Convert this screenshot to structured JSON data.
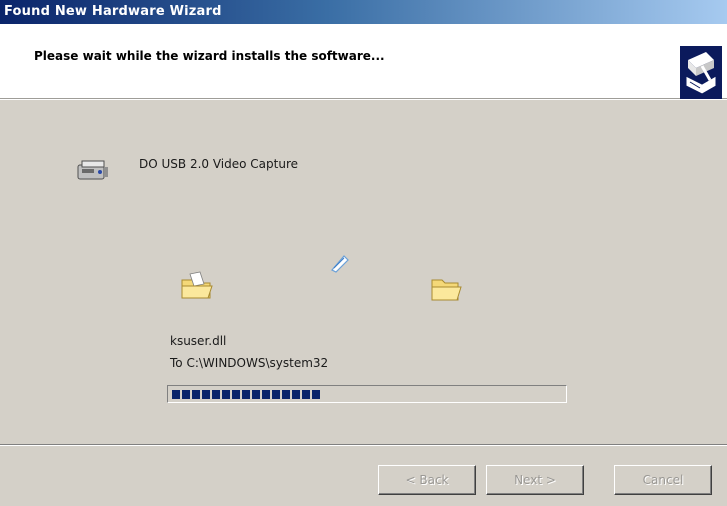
{
  "window": {
    "title": "Found New Hardware Wizard"
  },
  "header": {
    "heading": "Please wait while the wizard installs the software...",
    "icon": "hardware-wizard-icon"
  },
  "device": {
    "icon": "capture-device-icon",
    "name": "DO USB 2.0 Video Capture"
  },
  "copy": {
    "source_icon": "folder-icon",
    "flying_icon": "document-icon",
    "dest_icon": "folder-icon",
    "file_name": "ksuser.dll",
    "destination": "To C:\\WINDOWS\\system32",
    "progress_fraction": 0.4
  },
  "buttons": {
    "back_label": "< Back",
    "next_label": "Next >",
    "cancel_label": "Cancel",
    "enabled": false
  },
  "colors": {
    "titlebar_start": "#0a246a",
    "titlebar_end": "#a6caf0",
    "dialog_background": "#d4d0c8",
    "progress_fill": "#0a246a"
  }
}
